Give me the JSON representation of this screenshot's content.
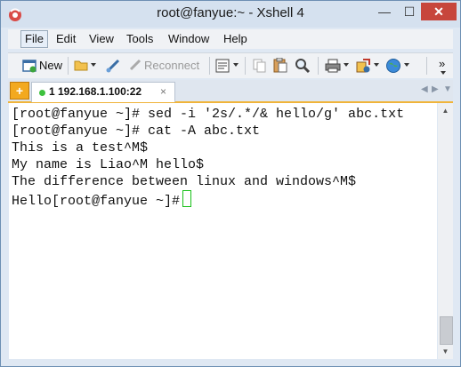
{
  "window": {
    "title": "root@fanyue:~ - Xshell 4",
    "minimize": "—",
    "maximize": "☐",
    "close": "✕"
  },
  "menu": [
    "File",
    "Edit",
    "View",
    "Tools",
    "Window",
    "Help"
  ],
  "toolbar": {
    "new_label": "New",
    "reconnect_label": "Reconnect",
    "overflow": "»"
  },
  "tab": {
    "plus": "+",
    "label": "1 192.168.1.100:22",
    "close": "×",
    "status_color": "#3ec13e",
    "nav_prev": "◀",
    "nav_next": "▶",
    "nav_more": "▼"
  },
  "terminal": {
    "lines": [
      "[root@fanyue ~]# sed -i '2s/.*/& hello/g' abc.txt",
      "[root@fanyue ~]# cat -A abc.txt",
      "This is a test^M$",
      "My name is Liao^M hello$",
      "The difference between linux and windows^M$",
      "Hello[root@fanyue ~]#"
    ],
    "cursor_color": "#18c018"
  },
  "scrollbar": {
    "up": "▲",
    "down": "▼"
  }
}
